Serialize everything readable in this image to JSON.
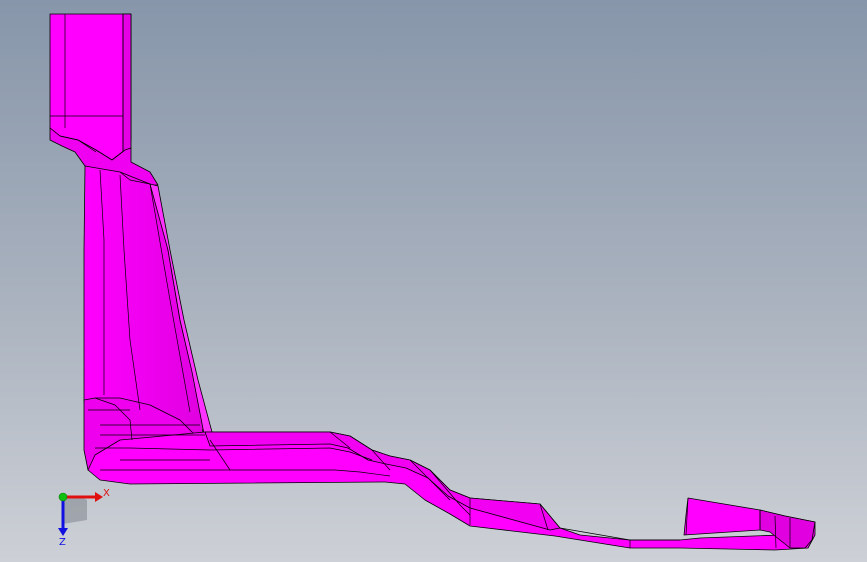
{
  "viewport": {
    "background_top": "#8796aa",
    "background_bottom": "#cdd0d6"
  },
  "model": {
    "name": "sheet-metal-part",
    "face_color": "#ff00ff",
    "shade_color": "#d600d6",
    "edge_color": "#000000"
  },
  "triad": {
    "x_label": "X",
    "z_label": "Z",
    "x_color": "#e01010",
    "y_color": "#10c010",
    "z_color": "#1010e0"
  }
}
